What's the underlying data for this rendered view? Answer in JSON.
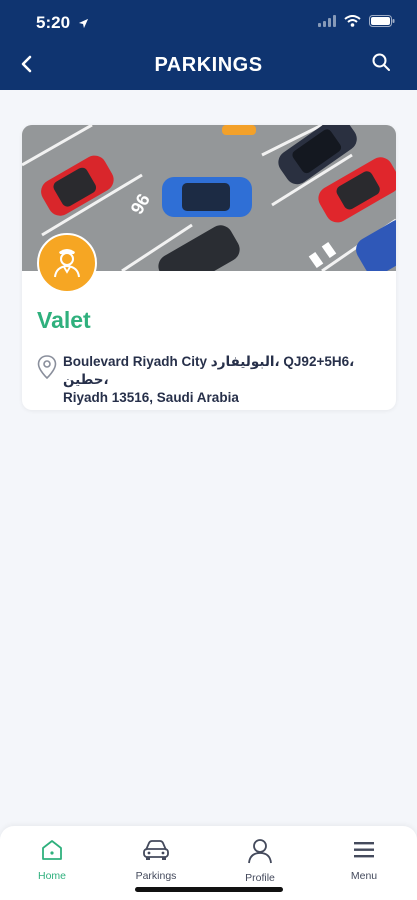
{
  "status_bar": {
    "time": "5:20"
  },
  "header": {
    "title": "PARKINGS"
  },
  "parking_card": {
    "title": "Valet",
    "address": "Boulevard Riyadh City البوليفارد، QJ92+5H6، حطين،\nRiyadh 13516, Saudi Arabia",
    "image_markings": {
      "spot_number": "96"
    }
  },
  "tab_bar": {
    "tabs": [
      {
        "label": "Home",
        "icon": "home-icon",
        "active": true
      },
      {
        "label": "Parkings",
        "icon": "car-icon",
        "active": false
      },
      {
        "label": "Profile",
        "icon": "profile-icon",
        "active": false
      },
      {
        "label": "Menu",
        "icon": "menu-icon",
        "active": false
      }
    ]
  },
  "colors": {
    "header_bg": "#0f3470",
    "accent_green": "#2fb07d",
    "badge_orange": "#f6a623",
    "page_bg": "#f4f6fa"
  }
}
